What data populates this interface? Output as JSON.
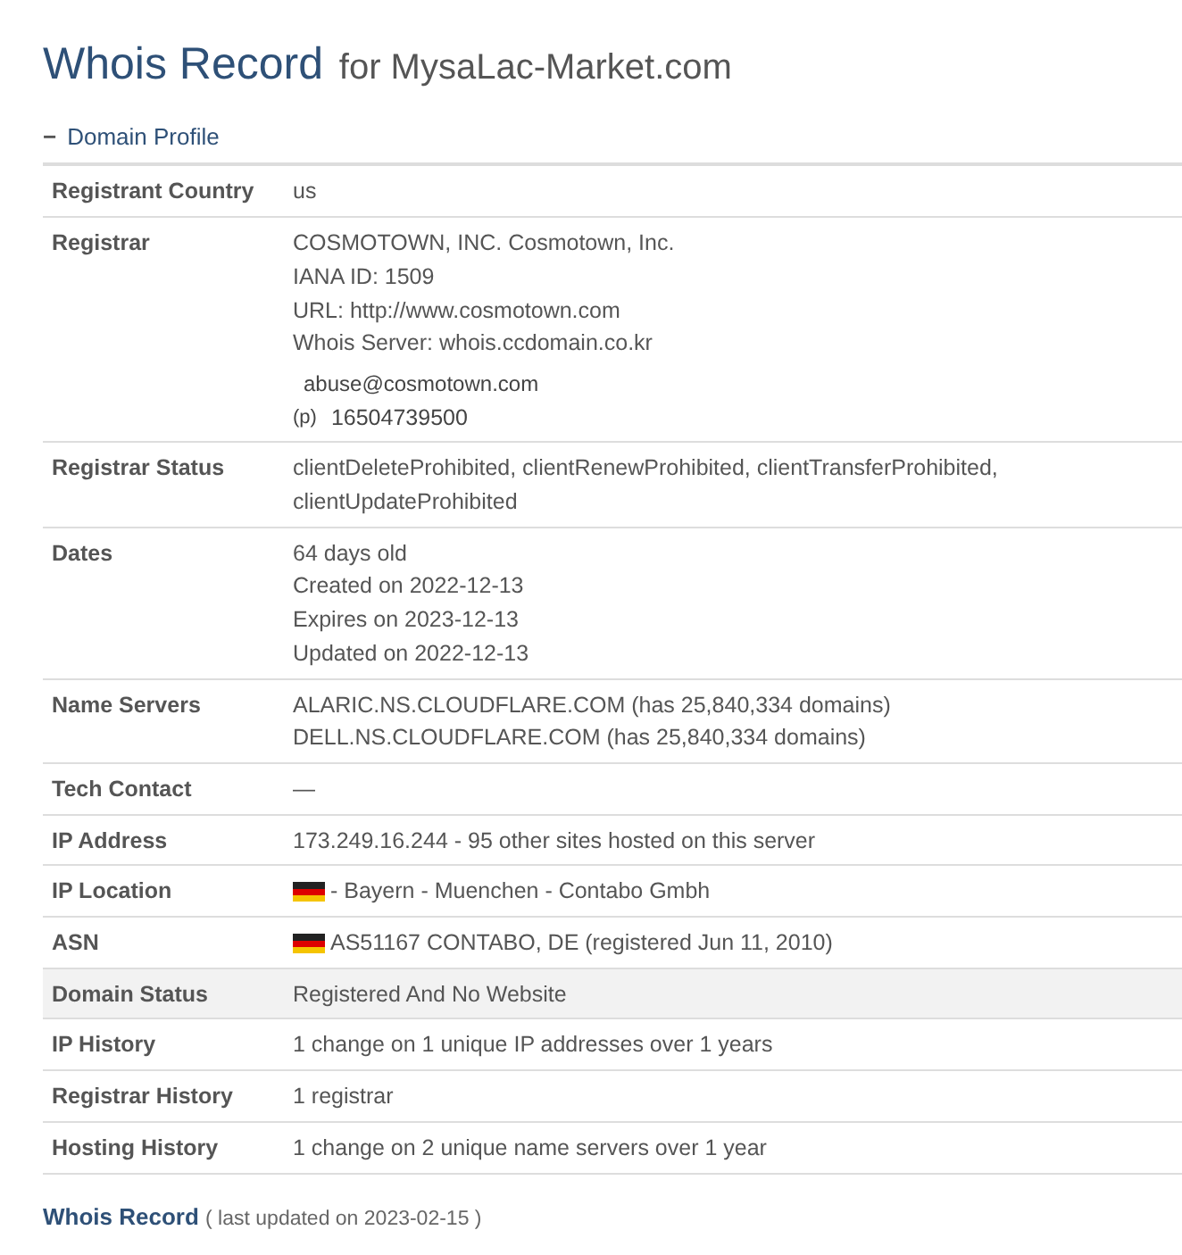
{
  "heading": {
    "title": "Whois Record",
    "subtitle": "for MysaLac-Market.com"
  },
  "section": {
    "toggle": "−",
    "title": "Domain Profile",
    "expanded": true
  },
  "rows": [
    {
      "label": "Registrant Country",
      "highlighted": false,
      "flag": false,
      "lines": [
        {
          "kind": "text",
          "text": "us"
        }
      ]
    },
    {
      "label": "Registrar",
      "highlighted": false,
      "flag": false,
      "lines": [
        {
          "kind": "text",
          "text": "COSMOTOWN, INC. Cosmotown, Inc."
        },
        {
          "kind": "text",
          "text": "IANA ID: 1509"
        },
        {
          "kind": "text",
          "text": "URL: http://www.cosmotown.com"
        },
        {
          "kind": "text",
          "text": "Whois Server: whois.ccdomain.co.kr"
        },
        {
          "kind": "email",
          "text": "abuse@cosmotown.com"
        },
        {
          "kind": "phone",
          "prefix": "(p)",
          "text": "16504739500"
        }
      ]
    },
    {
      "label": "Registrar Status",
      "highlighted": false,
      "flag": false,
      "lines": [
        {
          "kind": "text",
          "text": "clientDeleteProhibited, clientRenewProhibited, clientTransferProhibited, clientUpdateProhibited"
        }
      ]
    },
    {
      "label": "Dates",
      "highlighted": false,
      "flag": false,
      "lines": [
        {
          "kind": "text",
          "text": "64 days old"
        },
        {
          "kind": "text",
          "text": "Created on 2022-12-13"
        },
        {
          "kind": "text",
          "text": "Expires on 2023-12-13"
        },
        {
          "kind": "text",
          "text": "Updated on 2022-12-13"
        }
      ]
    },
    {
      "label": "Name Servers",
      "highlighted": false,
      "flag": false,
      "lines": [
        {
          "kind": "text",
          "text": "ALARIC.NS.CLOUDFLARE.COM (has 25,840,334 domains)"
        },
        {
          "kind": "text",
          "text": "DELL.NS.CLOUDFLARE.COM (has 25,840,334 domains)"
        }
      ]
    },
    {
      "label": "Tech Contact",
      "highlighted": false,
      "flag": false,
      "lines": [
        {
          "kind": "text",
          "text": "—"
        }
      ]
    },
    {
      "label": "IP Address",
      "highlighted": false,
      "flag": false,
      "lines": [
        {
          "kind": "text",
          "text": "173.249.16.244 - 95 other sites hosted on this server"
        }
      ]
    },
    {
      "label": "IP Location",
      "highlighted": false,
      "flag": true,
      "lines": [
        {
          "kind": "text",
          "text": "- Bayern - Muenchen - Contabo Gmbh"
        }
      ]
    },
    {
      "label": "ASN",
      "highlighted": false,
      "flag": true,
      "lines": [
        {
          "kind": "text",
          "text": "AS51167 CONTABO, DE (registered Jun 11, 2010)"
        }
      ]
    },
    {
      "label": "Domain Status",
      "highlighted": true,
      "flag": false,
      "lines": [
        {
          "kind": "text",
          "text": "Registered And No Website"
        }
      ]
    },
    {
      "label": "IP History",
      "highlighted": false,
      "flag": false,
      "lines": [
        {
          "kind": "text",
          "text": "1 change on 1 unique IP addresses over 1 years"
        }
      ]
    },
    {
      "label": "Registrar History",
      "highlighted": false,
      "flag": false,
      "lines": [
        {
          "kind": "text",
          "text": "1 registrar"
        }
      ]
    },
    {
      "label": "Hosting History",
      "highlighted": false,
      "flag": false,
      "lines": [
        {
          "kind": "text",
          "text": "1 change on 2 unique name servers over 1 year"
        }
      ]
    }
  ],
  "footer": {
    "title": "Whois Record",
    "note": "( last updated on 2023-02-15 )"
  }
}
